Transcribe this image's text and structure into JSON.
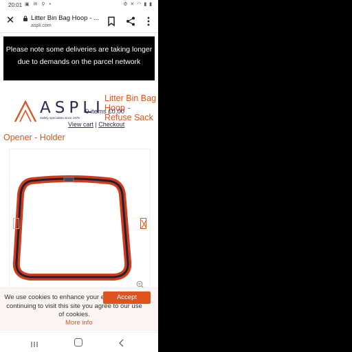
{
  "status_bar": {
    "time": "20:01",
    "left_icons": "▣ ✉ ⚲ •",
    "right_icons": "⚙ ✕ ◠ ▮ ▮"
  },
  "browser": {
    "page_title": "Litter Bin Bag Hoop - ...",
    "url": "aspli.com",
    "close_icon": "close-icon",
    "bookmark_icon": "bookmark-icon",
    "share_icon": "share-icon",
    "menu_icon": "more-vert-icon"
  },
  "notice": {
    "text": "Please note some deliveries are taking longer due to demands on the parcel network"
  },
  "logo": {
    "word": "ASPLI",
    "tagline": "Safety specialists since 1978"
  },
  "cart": {
    "items_text": "0 items £0.00",
    "view_cart": "View cart",
    "separator": "|",
    "checkout": "Checkout"
  },
  "product": {
    "title_part1": "Litter Bin Bag Hoop - Refuse Sack",
    "title_part2": "Opener - Holder"
  },
  "cookie": {
    "text": "We use cookies to enhance your experience. By continuing to visit this site you agree to our use of cookies.",
    "accept_label": "Accept",
    "more_info": "More info"
  },
  "colors": {
    "brand_orange": "#e0531e",
    "navy": "#2b2b55",
    "hoop_red": "#d23a1c"
  }
}
